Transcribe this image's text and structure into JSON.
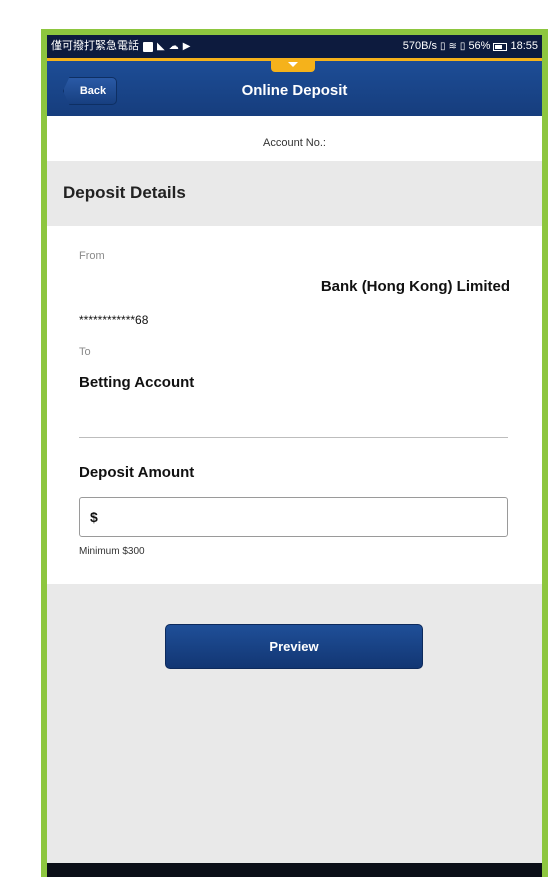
{
  "status_bar": {
    "left_text": "僅可撥打緊急電話",
    "right_text": "570B/s",
    "battery": "56%",
    "time": "18:55"
  },
  "header": {
    "back_label": "Back",
    "title": "Online Deposit"
  },
  "account": {
    "label": "Account No.:"
  },
  "section": {
    "title": "Deposit Details"
  },
  "from": {
    "label": "From",
    "bank": "Bank (Hong Kong) Limited",
    "account_masked": "************68"
  },
  "to": {
    "label": "To",
    "account": "Betting Account"
  },
  "deposit": {
    "label": "Deposit Amount",
    "prefix": "$",
    "hint": "Minimum $300"
  },
  "actions": {
    "preview_label": "Preview"
  },
  "colors": {
    "frame_green": "#8dc63f",
    "header_blue": "#1d4d96",
    "accent_gold": "#f5b21b"
  }
}
